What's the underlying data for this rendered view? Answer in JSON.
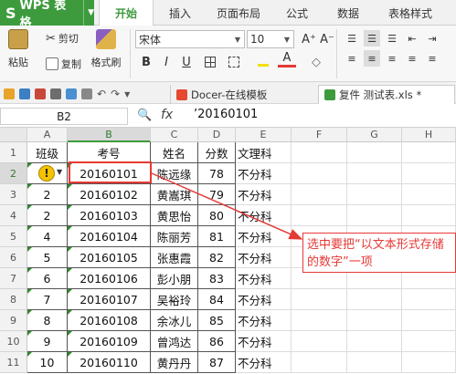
{
  "app": {
    "title": "WPS 表格"
  },
  "tabs": [
    "开始",
    "插入",
    "页面布局",
    "公式",
    "数据",
    "表格样式"
  ],
  "active_tab": "开始",
  "ribbon": {
    "paste": "粘贴",
    "cut": "剪切",
    "copy": "复制",
    "format_painter": "格式刷",
    "font_name": "宋体",
    "font_size": "10",
    "bold": "B",
    "italic": "I",
    "underline": "U",
    "grow_font": "A⁺",
    "shrink_font": "A⁻"
  },
  "quick_access": {
    "docer_tab": "Docer-在线模板",
    "file_tab": "复件 测试表.xls *"
  },
  "formula_bar": {
    "name_box": "B2",
    "fx": "fx",
    "value": "’20160101"
  },
  "columns": [
    "A",
    "B",
    "C",
    "D",
    "E",
    "F",
    "G",
    "H"
  ],
  "selected_column": "B",
  "selected_row": "2",
  "rows": [
    {
      "n": "1",
      "a": "班级",
      "b": "考号",
      "c": "姓名",
      "d": "分数",
      "e": "文理科"
    },
    {
      "n": "2",
      "a": "",
      "b": "20160101",
      "c": "陈远缘",
      "d": "78",
      "e": "不分科"
    },
    {
      "n": "3",
      "a": "2",
      "b": "20160102",
      "c": "黄嵩琪",
      "d": "79",
      "e": "不分科"
    },
    {
      "n": "4",
      "a": "2",
      "b": "20160103",
      "c": "黄思怡",
      "d": "80",
      "e": "不分科"
    },
    {
      "n": "5",
      "a": "4",
      "b": "20160104",
      "c": "陈丽芳",
      "d": "81",
      "e": "不分科"
    },
    {
      "n": "6",
      "a": "5",
      "b": "20160105",
      "c": "张惠霞",
      "d": "82",
      "e": "不分科"
    },
    {
      "n": "7",
      "a": "6",
      "b": "20160106",
      "c": "彭小朋",
      "d": "83",
      "e": "不分科"
    },
    {
      "n": "8",
      "a": "7",
      "b": "20160107",
      "c": "吴裕玲",
      "d": "84",
      "e": "不分科"
    },
    {
      "n": "9",
      "a": "8",
      "b": "20160108",
      "c": "余冰儿",
      "d": "85",
      "e": "不分科"
    },
    {
      "n": "10",
      "a": "9",
      "b": "20160109",
      "c": "曾鸿达",
      "d": "86",
      "e": "不分科"
    },
    {
      "n": "11",
      "a": "10",
      "b": "20160110",
      "c": "黄丹丹",
      "d": "87",
      "e": "不分科"
    }
  ],
  "annotation": "选中要把“以文本形式存储的数字”一项",
  "colors": {
    "brand_green": "#3d9b3d",
    "annotation_red": "#e53935",
    "warning_yellow": "#f5c400"
  }
}
